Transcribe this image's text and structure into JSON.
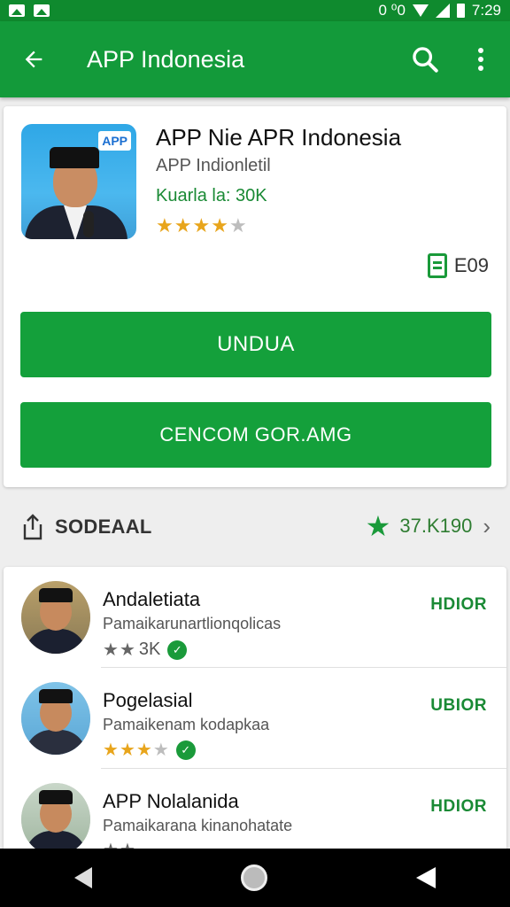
{
  "status_bar": {
    "left_icons": [
      "image-icon",
      "image-icon"
    ],
    "indicators": "0 ⁰0",
    "time": "7:29"
  },
  "app_bar": {
    "title": "APP Indonesia",
    "icons": [
      "back-arrow-icon",
      "search-icon",
      "more-vert-icon"
    ]
  },
  "app": {
    "name": "APP Nie APR Indonesia",
    "developer": "APP Indionletil",
    "downloads": "Kuarla la: 30K",
    "rating_stars": 4,
    "icon_badge": "APP",
    "size": "E09",
    "install_label": "UNDUA",
    "secondary_label": "CENCOM GOR.AMG"
  },
  "section": {
    "label": "SODEAAL",
    "rating_text": "37.K190"
  },
  "list": [
    {
      "name": "Andaletiata",
      "desc": "Pamaikarunartlionqolicas",
      "stars": 2,
      "meta": "3K",
      "action": "HDIOR"
    },
    {
      "name": "Pogelasial",
      "desc": "Pamaikenam kodapkaa",
      "stars": 3,
      "meta": "",
      "action": "UBIOR"
    },
    {
      "name": "APP Nolalanida",
      "desc": "Pamaikarana kinanohatate",
      "stars": 2,
      "meta": "",
      "action": "HDIOR"
    }
  ],
  "colors": {
    "primary": "#139a3a",
    "status_bar": "#0f8a2e",
    "star": "#e8a51c"
  }
}
